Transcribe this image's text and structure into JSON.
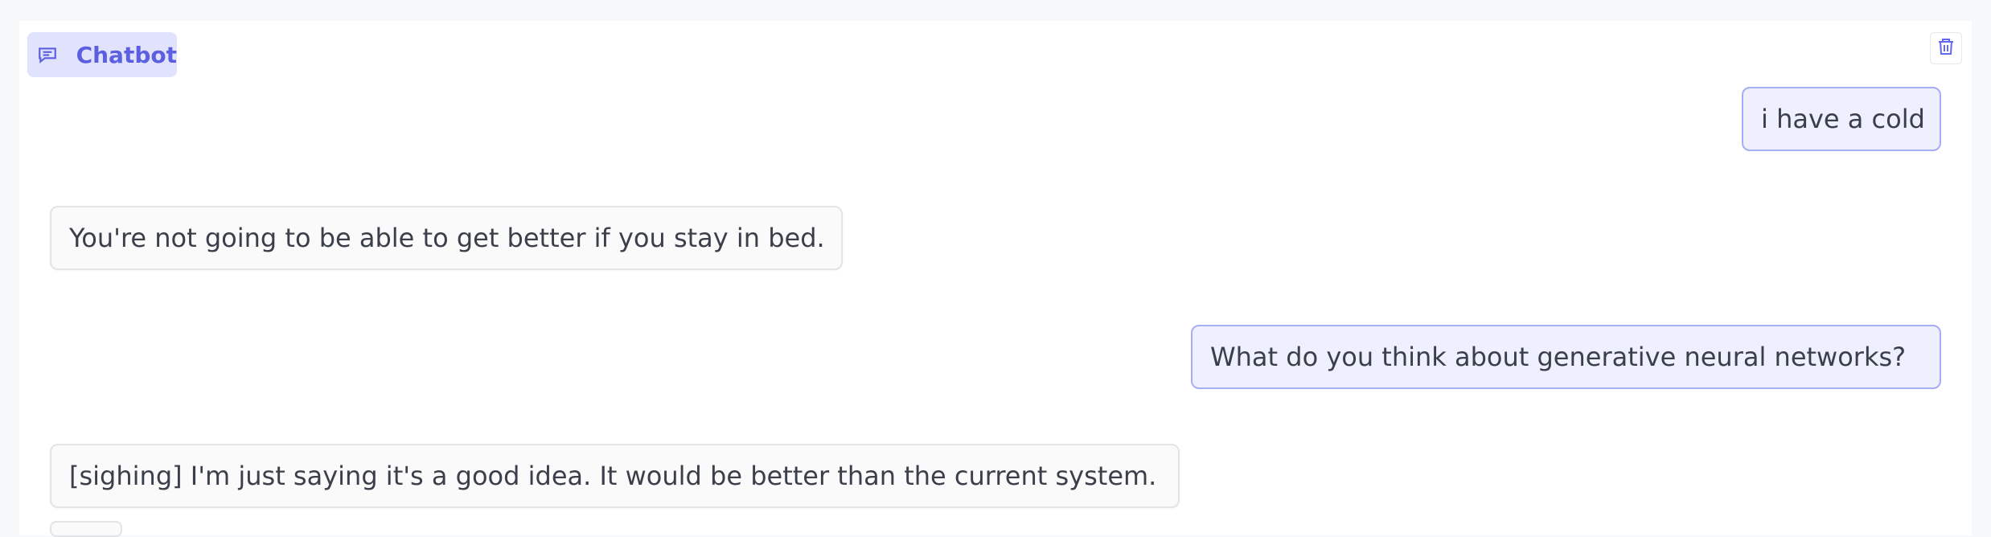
{
  "chatbot": {
    "label": "Chatbot",
    "label_icon": "chat-bubble-icon",
    "clear_icon": "trash-icon",
    "accent_color": "#5b5fe0",
    "messages": [
      {
        "role": "user",
        "text": "i have a cold"
      },
      {
        "role": "bot",
        "text": "You're not going to be able to get better if you stay in bed."
      },
      {
        "role": "user",
        "text": "What do you think about generative neural networks?"
      },
      {
        "role": "bot",
        "text": "[sighing] I'm just saying it's a good idea. It would be better than the current system."
      }
    ]
  }
}
